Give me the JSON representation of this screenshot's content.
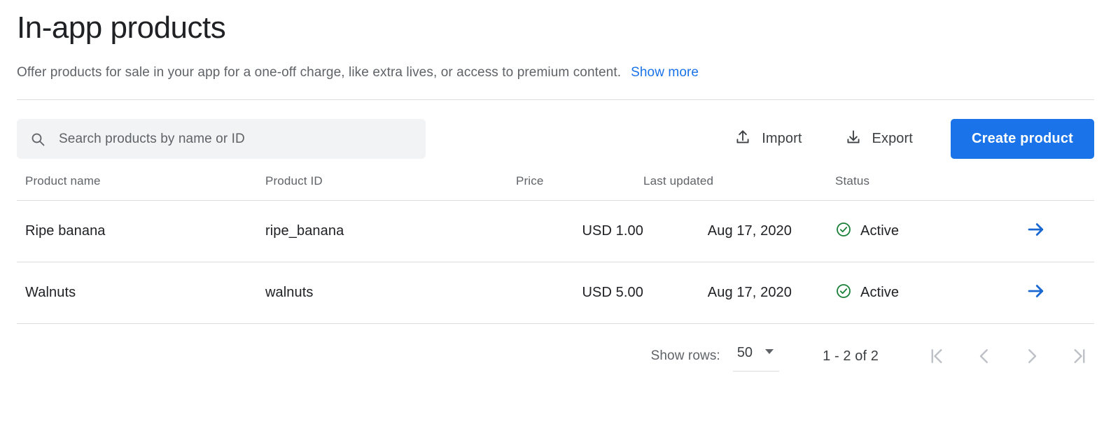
{
  "header": {
    "title": "In-app products",
    "subtitle": "Offer products for sale in your app for a one-off charge, like extra lives, or access to premium content.",
    "show_more_label": "Show more"
  },
  "toolbar": {
    "search_placeholder": "Search products by name or ID",
    "search_value": "",
    "import_label": "Import",
    "export_label": "Export",
    "create_label": "Create product"
  },
  "table": {
    "columns": {
      "name": "Product name",
      "id": "Product ID",
      "price": "Price",
      "last_updated": "Last updated",
      "status": "Status"
    },
    "rows": [
      {
        "name": "Ripe banana",
        "id": "ripe_banana",
        "price": "USD 1.00",
        "last_updated": "Aug 17, 2020",
        "status": "Active"
      },
      {
        "name": "Walnuts",
        "id": "walnuts",
        "price": "USD 5.00",
        "last_updated": "Aug 17, 2020",
        "status": "Active"
      }
    ]
  },
  "footer": {
    "show_rows_label": "Show rows:",
    "rows_per_page": "50",
    "range_label": "1 - 2 of 2"
  },
  "colors": {
    "accent_blue": "#1a73e8",
    "status_green": "#188038",
    "text_primary": "#202124",
    "text_secondary": "#5f6368",
    "divider": "#dadce0",
    "search_bg": "#f1f3f4",
    "pager_disabled": "#bdc1c6"
  }
}
